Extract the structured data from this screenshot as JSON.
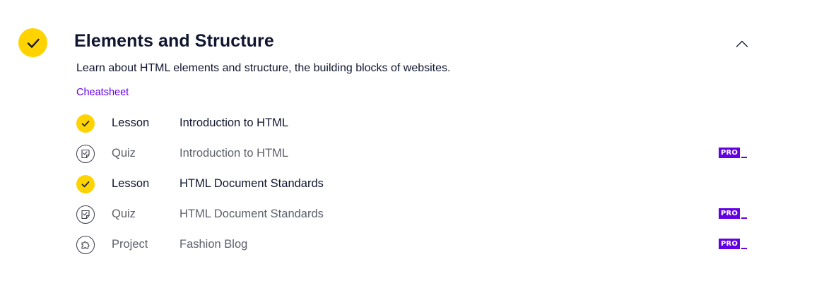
{
  "module": {
    "title": "Elements and Structure",
    "description": "Learn about HTML elements and structure, the building blocks of websites.",
    "completed": true,
    "expanded": true,
    "cheatsheet_label": "Cheatsheet",
    "toggle_icon": "chevron-up-icon",
    "colors": {
      "accent_yellow": "#ffd300",
      "link_purple": "#6400e4",
      "pro_badge": "#6400e4",
      "text_dark": "#10162f",
      "text_muted": "#5d5f69"
    }
  },
  "items": [
    {
      "type": "Lesson",
      "name": "Introduction to HTML",
      "status": "completed",
      "icon": "checkmark-icon",
      "pro": false
    },
    {
      "type": "Quiz",
      "name": "Introduction to HTML",
      "status": "locked",
      "icon": "quiz-icon",
      "pro": true,
      "pro_label": "PRO"
    },
    {
      "type": "Lesson",
      "name": "HTML Document Standards",
      "status": "completed",
      "icon": "checkmark-icon",
      "pro": false
    },
    {
      "type": "Quiz",
      "name": "HTML Document Standards",
      "status": "locked",
      "icon": "quiz-icon",
      "pro": true,
      "pro_label": "PRO"
    },
    {
      "type": "Project",
      "name": "Fashion Blog",
      "status": "locked",
      "icon": "puzzle-icon",
      "pro": true,
      "pro_label": "PRO"
    }
  ]
}
